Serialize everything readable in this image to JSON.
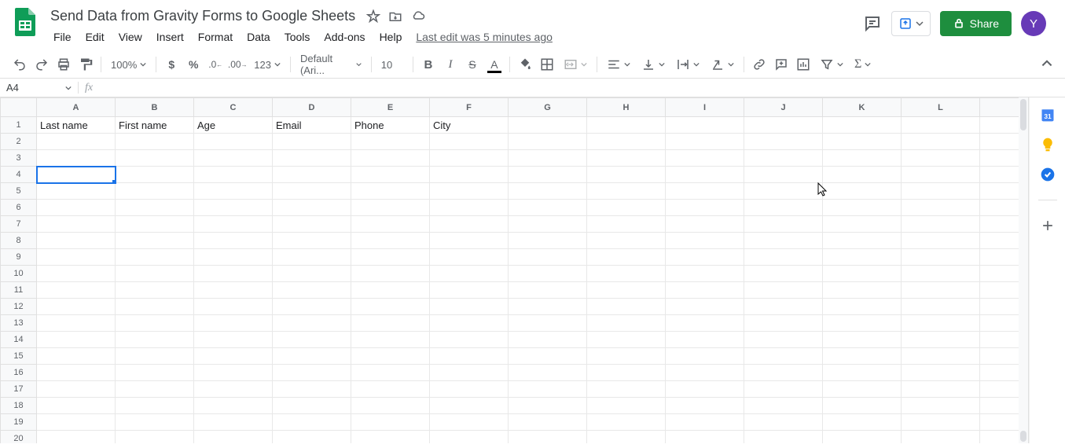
{
  "doc": {
    "title": "Send Data from Gravity Forms to Google Sheets"
  },
  "menu": {
    "items": [
      "File",
      "Edit",
      "View",
      "Insert",
      "Format",
      "Data",
      "Tools",
      "Add-ons",
      "Help"
    ],
    "last_edit": "Last edit was 5 minutes ago"
  },
  "toolbar": {
    "zoom": "100%",
    "font": "Default (Ari...",
    "font_size": "10",
    "number_format": "123"
  },
  "share": {
    "label": "Share"
  },
  "avatar": {
    "initial": "Y"
  },
  "formula": {
    "name_box": "A4",
    "value": ""
  },
  "columns": [
    "A",
    "B",
    "C",
    "D",
    "E",
    "F",
    "G",
    "H",
    "I",
    "J",
    "K",
    "L"
  ],
  "row_count": 20,
  "selected_cell": {
    "row": 4,
    "col": 0
  },
  "cell_data": {
    "1": {
      "A": "Last name",
      "B": "First name",
      "C": "Age",
      "D": "Email",
      "E": "Phone",
      "F": "City"
    }
  },
  "side_panel": {
    "calendar_day": "31"
  }
}
